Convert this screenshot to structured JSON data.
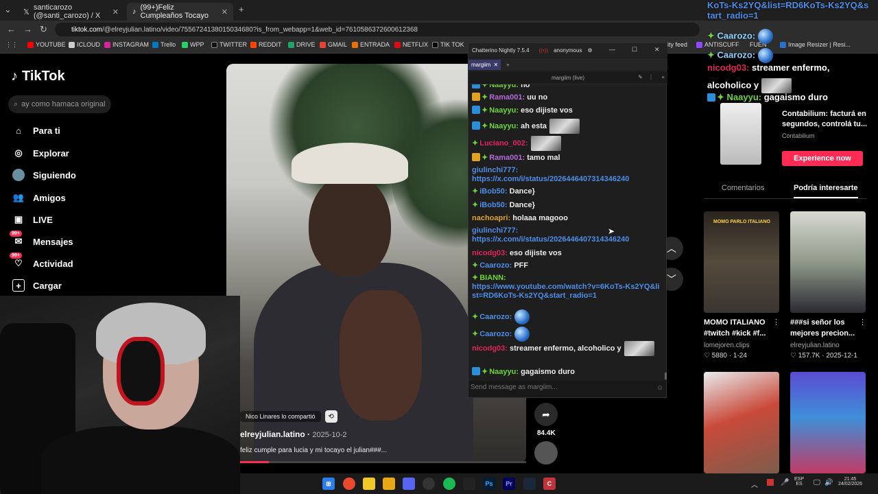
{
  "browser": {
    "tabs": [
      {
        "title": "santicarozo (@santi_carozo) / X",
        "active": false
      },
      {
        "title": "(99+)Feliz Cumpleaños Tocayo",
        "active": true
      }
    ],
    "url_host": "tiktok.com",
    "url_path": "/@elreyjulian.latino/video/7556724138015034680?is_from_webapp=1&web_id=7610586372600612368",
    "bookmarks": [
      "YOUTUBE",
      "ICLOUD",
      "INSTAGRAM",
      "Trello",
      "WPP",
      "TWITTER",
      "REDDIT",
      "DRIVE",
      "GMAIL",
      "ENTRADA",
      "NETFLIX",
      "TIK TOK",
      "ity feed",
      "ANTISCUFF",
      "FUEN",
      "Image Resizer | Resi..."
    ]
  },
  "tiktok": {
    "logo": "TikTok",
    "search_placeholder": "ay como hamaca original",
    "nav": [
      {
        "label": "Para ti",
        "icon": "home-icon"
      },
      {
        "label": "Explorar",
        "icon": "compass-icon"
      },
      {
        "label": "Siguiendo",
        "icon": "avatar-icon"
      },
      {
        "label": "Amigos",
        "icon": "friends-icon"
      },
      {
        "label": "LIVE",
        "icon": "live-icon"
      },
      {
        "label": "Mensajes",
        "icon": "messages-icon",
        "badge": "99+"
      },
      {
        "label": "Actividad",
        "icon": "activity-icon",
        "badge": "99+"
      },
      {
        "label": "Cargar",
        "icon": "upload-icon"
      }
    ],
    "video": {
      "shared_by": "Nico Linares lo compartió",
      "author": "elreyjulian.latino",
      "date": "2025-10-2",
      "caption": "feliz cumple para lucia y mi tocayo el julian###...",
      "share_count": "84.4K",
      "progress_fraction": 0.1
    }
  },
  "chatterino": {
    "title": "Chatterino Nightly 7.5.4",
    "user": "anonymous",
    "tab": "margiim",
    "channel_header": "margiim (live)",
    "input_placeholder": "Send message as margiim...",
    "messages": [
      {
        "badges": [
          "prime",
          "star"
        ],
        "user": "Naayyu:",
        "color": "#6fd43a",
        "text": "no"
      },
      {
        "badges": [
          "sub",
          "star"
        ],
        "user": "Rama001:",
        "color": "#b56bd9",
        "text": "uu no"
      },
      {
        "badges": [
          "prime",
          "star"
        ],
        "user": "Naayyu:",
        "color": "#6fd43a",
        "text": "eso dijiste vos"
      },
      {
        "badges": [
          "prime",
          "star"
        ],
        "user": "Naayyu:",
        "color": "#6fd43a",
        "text": "ah esta",
        "emote": true
      },
      {
        "badges": [
          "star"
        ],
        "user": "Luciano_002:",
        "color": "#e0245e",
        "text": "",
        "emote": true
      },
      {
        "badges": [
          "sub",
          "star"
        ],
        "user": "Rama001:",
        "color": "#b56bd9",
        "text": "tamo mal"
      },
      {
        "badges": [],
        "user": "giulinchi777:",
        "color": "#4e8ee8",
        "link": "https://x.com/i/status/2026446407314346240"
      },
      {
        "badges": [
          "star"
        ],
        "user": "iBob50:",
        "color": "#4e8ee8",
        "text": "Dance}"
      },
      {
        "badges": [
          "star"
        ],
        "user": "iBob50:",
        "color": "#4e8ee8",
        "text": "Dance}"
      },
      {
        "badges": [],
        "user": "nachoapri:",
        "color": "#e1a221",
        "text": "holaaa magooo"
      },
      {
        "badges": [],
        "user": "giulinchi777:",
        "color": "#4e8ee8",
        "link": "https://x.com/i/status/2026446407314346240"
      },
      {
        "badges": [],
        "user": "nicodg03:",
        "color": "#e0245e",
        "text": "eso dijiste vos"
      },
      {
        "badges": [
          "star"
        ],
        "user": "Caarozo:",
        "color": "#4e8ee8",
        "text": "PFF"
      },
      {
        "badges": [
          "star"
        ],
        "user": "BIANN:",
        "color": "#6fd43a",
        "link": "https://www.youtube.com/watch?v=6KoTs-Ks2YQ&list=RD6KoTs-Ks2YQ&start_radio=1"
      },
      {
        "badges": [
          "star"
        ],
        "user": "Caarozo:",
        "color": "#4e8ee8",
        "globe": true
      },
      {
        "badges": [
          "star"
        ],
        "user": "Caarozo:",
        "color": "#4e8ee8",
        "globe": true
      },
      {
        "badges": [],
        "user": "nicodg03:",
        "color": "#e0245e",
        "text": "streamer enfermo, alcoholico y",
        "emote": true
      },
      {
        "badges": [
          "prime",
          "star"
        ],
        "user": "Naayyu:",
        "color": "#6fd43a",
        "text": "gagaismo duro"
      }
    ]
  },
  "overlay": {
    "link_tail_1": "KoTs-Ks2YQ&list=RD6KoTs-Ks2YQ&s",
    "link_tail_2": "tart_radio=1",
    "user_caarozo": "Caarozo:",
    "user_nicodg": "nicodg03:",
    "nicodg_text": "streamer enfermo,",
    "nicodg_text2": "alcoholico y",
    "user_naayyu": "Naayyu:",
    "naayyu_text": "gagaismo duro"
  },
  "ad": {
    "title": "Contabilium: facturá en segundos, controlá tu...",
    "brand": "Contabilium",
    "button": "Experience now"
  },
  "right_tabs": [
    "Comentarios",
    "Podría interesarte"
  ],
  "recommendations": [
    {
      "title": "MOMO ITALIANO #twitch #kick #f...",
      "author": "lomejoren.clips",
      "likes": "5880",
      "date": "1-24",
      "thumb_label": "MOMO PARLO ITALIANO"
    },
    {
      "title": "###si señor los mejores precion...",
      "author": "elreyjulian.latino",
      "likes": "157.7K",
      "date": "2025-12-1"
    }
  ],
  "taskbar": {
    "lang_top": "ESP",
    "lang_bottom": "ES",
    "time": "21:45",
    "date": "24/02/2026"
  }
}
